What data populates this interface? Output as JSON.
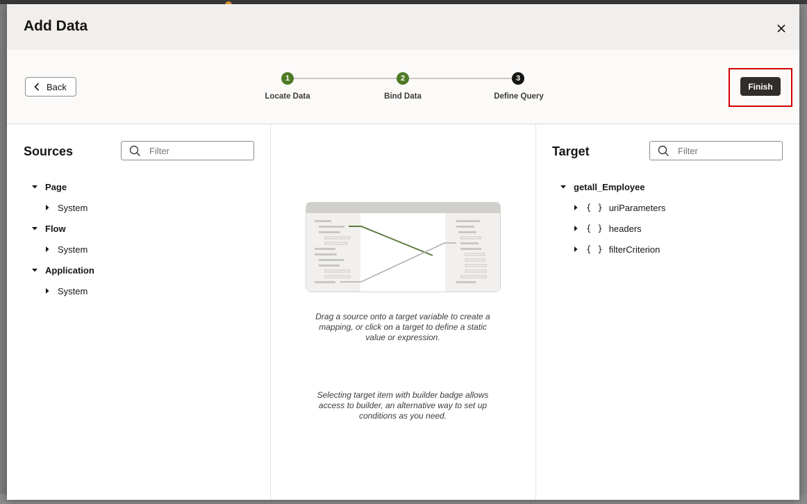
{
  "dialog": {
    "title": "Add Data"
  },
  "wizard": {
    "back_label": "Back",
    "finish_label": "Finish",
    "steps": [
      {
        "number": "1",
        "label": "Locate Data",
        "state": "done"
      },
      {
        "number": "2",
        "label": "Bind Data",
        "state": "done"
      },
      {
        "number": "3",
        "label": "Define Query",
        "state": "current"
      }
    ]
  },
  "sources": {
    "title": "Sources",
    "filter_placeholder": "Filter",
    "tree": [
      {
        "label": "Page",
        "expanded": true,
        "children": [
          "System"
        ]
      },
      {
        "label": "Flow",
        "expanded": true,
        "children": [
          "System"
        ]
      },
      {
        "label": "Application",
        "expanded": true,
        "children": [
          "System"
        ]
      }
    ]
  },
  "middle": {
    "help_mapping": "Drag a source onto a target variable to create a mapping, or click on a target to define a static value or expression.",
    "help_builder": "Selecting target item with builder badge allows access to builder, an alternative way to set up conditions as you need."
  },
  "target": {
    "title": "Target",
    "filter_placeholder": "Filter",
    "root": "getall_Employee",
    "children": [
      {
        "icon": "{ }",
        "label": "uriParameters"
      },
      {
        "icon": "{ }",
        "label": "headers"
      },
      {
        "icon": "{ }",
        "label": "filterCriterion"
      }
    ]
  },
  "colors": {
    "step_done": "#4e7a25",
    "step_current": "#161513",
    "finish_button": "#312d2a",
    "highlight": "#d40000"
  }
}
